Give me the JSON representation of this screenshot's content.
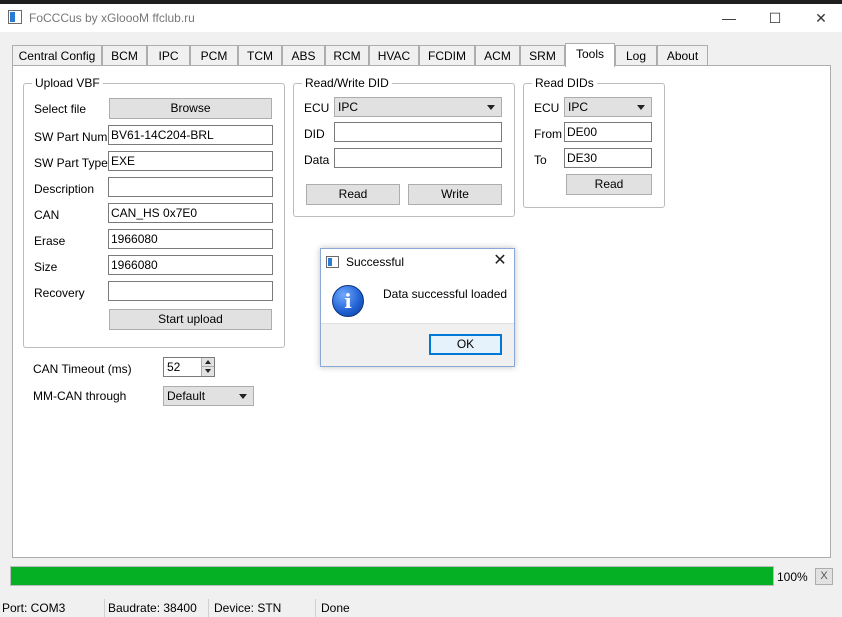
{
  "window": {
    "title": "FoCCCus by xGloooM ffclub.ru",
    "minimize_glyph": "—",
    "maximize_glyph": "☐",
    "close_glyph": "✕"
  },
  "tabs": [
    {
      "label": "Central Config"
    },
    {
      "label": "BCM"
    },
    {
      "label": "IPC"
    },
    {
      "label": "PCM"
    },
    {
      "label": "TCM"
    },
    {
      "label": "ABS"
    },
    {
      "label": "RCM"
    },
    {
      "label": "HVAC"
    },
    {
      "label": "FCDIM"
    },
    {
      "label": "ACM"
    },
    {
      "label": "SRM"
    },
    {
      "label": "Tools",
      "active": true
    },
    {
      "label": "Log"
    },
    {
      "label": "About"
    }
  ],
  "upload_vbf": {
    "title": "Upload VBF",
    "select_file_label": "Select file",
    "browse_label": "Browse",
    "sw_part_num_label": "SW Part Num",
    "sw_part_num_value": "BV61-14C204-BRL",
    "sw_part_type_label": "SW Part Type",
    "sw_part_type_value": "EXE",
    "description_label": "Description",
    "description_value": "",
    "can_label": "CAN",
    "can_value": "CAN_HS 0x7E0",
    "erase_label": "Erase",
    "erase_value": "1966080",
    "size_label": "Size",
    "size_value": "1966080",
    "recovery_label": "Recovery",
    "recovery_value": "",
    "start_upload_label": "Start upload"
  },
  "rw_did": {
    "title": "Read/Write DID",
    "ecu_label": "ECU",
    "ecu_value": "IPC",
    "did_label": "DID",
    "did_value": "",
    "data_label": "Data",
    "data_value": "",
    "read_label": "Read",
    "write_label": "Write"
  },
  "read_dids": {
    "title": "Read DIDs",
    "ecu_label": "ECU",
    "ecu_value": "IPC",
    "from_label": "From",
    "from_value": "DE00",
    "to_label": "To",
    "to_value": "DE30",
    "read_label": "Read"
  },
  "can_timeout": {
    "label": "CAN Timeout (ms)",
    "value": "52"
  },
  "mm_can": {
    "label": "MM-CAN through",
    "value": "Default"
  },
  "progress": {
    "percent": 100,
    "label": "100%",
    "color": "#06b025",
    "x_label": "X"
  },
  "status": {
    "port": "Port: COM3",
    "baudrate": "Baudrate: 38400",
    "device": "Device: STN",
    "state": "Done"
  },
  "dialog": {
    "title": "Successful",
    "close_glyph": "✕",
    "icon_glyph": "i",
    "message": "Data successful loaded",
    "ok_label": "OK"
  }
}
